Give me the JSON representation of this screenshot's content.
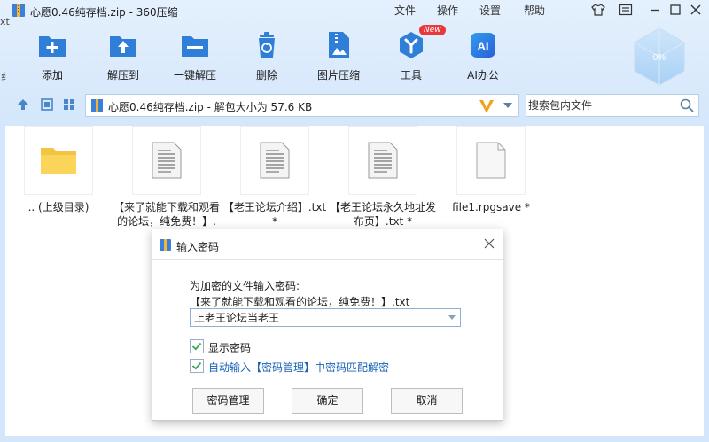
{
  "window": {
    "title": "心愿0.46纯存档.zip - 360压缩",
    "edge_text_top": "xt",
    "edge_text_mid": "纟"
  },
  "menu": [
    "文件",
    "操作",
    "设置",
    "帮助"
  ],
  "toolbar": {
    "items": [
      {
        "label": "添加",
        "icon": "add-icon"
      },
      {
        "label": "解压到",
        "icon": "extract-to-icon"
      },
      {
        "label": "一键解压",
        "icon": "one-click-extract-icon"
      },
      {
        "label": "删除",
        "icon": "trash-icon"
      },
      {
        "label": "图片压缩",
        "icon": "image-compress-icon"
      },
      {
        "label": "工具",
        "icon": "tools-icon",
        "badge": "New"
      },
      {
        "label": "AI办公",
        "icon": "ai-icon"
      }
    ],
    "gem_text": "0%"
  },
  "address": {
    "path": "心愿0.46纯存档.zip - 解包大小为 57.6 KB",
    "search_placeholder": "搜索包内文件"
  },
  "files": [
    {
      "name": ".. (上级目录)",
      "type": "folder"
    },
    {
      "name": "【来了就能下载和观看的论坛，纯免费！】.t...",
      "type": "text"
    },
    {
      "name": "【老王论坛介绍】.txt *",
      "type": "text"
    },
    {
      "name": "【老王论坛永久地址发布页】.txt *",
      "type": "text"
    },
    {
      "name": "file1.rpgsave *",
      "type": "blank"
    }
  ],
  "dialog": {
    "title": "输入密码",
    "prompt": "为加密的文件输入密码:",
    "file": "【来了就能下载和观看的论坛，纯免费！】.txt",
    "password": "上老王论坛当老王",
    "show_password": "显示密码",
    "auto_input": "自动输入【密码管理】中密码匹配解密",
    "buttons": {
      "manage": "密码管理",
      "ok": "确定",
      "cancel": "取消"
    }
  },
  "colors": {
    "accent": "#2f7fd8",
    "check": "#3aa655",
    "badge": "#e8383d",
    "v_logo": "#f0a31a"
  }
}
